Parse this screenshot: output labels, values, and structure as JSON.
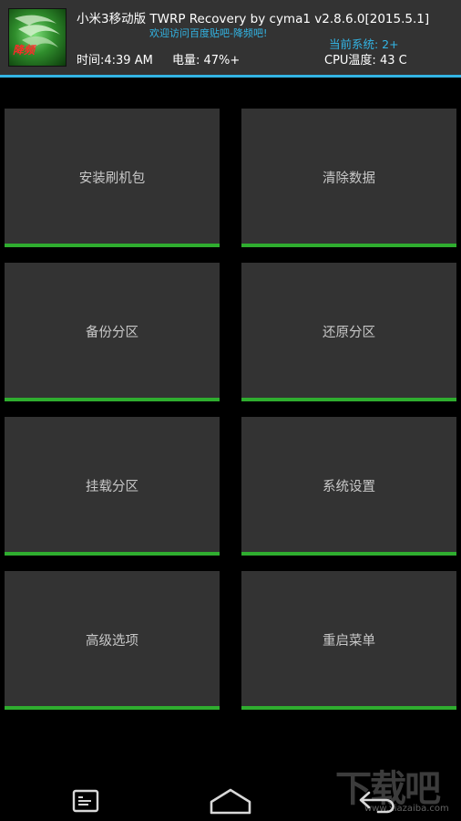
{
  "header": {
    "title": "小米3移动版 TWRP Recovery by cyma1 v2.8.6.0[2015.5.1]",
    "welcome": "欢迎访问百度贴吧-降频吧!",
    "current_system": "当前系统: 2+",
    "time": "时间:4:39 AM",
    "battery": "电量: 47%+",
    "cpu_temp": "CPU温度: 43 C",
    "logo_text": "降频"
  },
  "tiles": [
    {
      "label": "安装刷机包"
    },
    {
      "label": "清除数据"
    },
    {
      "label": "备份分区"
    },
    {
      "label": "还原分区"
    },
    {
      "label": "挂载分区"
    },
    {
      "label": "系统设置"
    },
    {
      "label": "高级选项"
    },
    {
      "label": "重启菜单"
    }
  ],
  "navbar": {
    "buttons": [
      "console-icon",
      "home-icon",
      "back-icon"
    ]
  },
  "watermark": {
    "text": "下载吧",
    "url": "www.xiazaiba.com"
  },
  "colors": {
    "accent_blue": "#33b5e5",
    "tile_bar_green": "#2fad2f",
    "tile_bg": "#333333",
    "background": "#000000"
  }
}
